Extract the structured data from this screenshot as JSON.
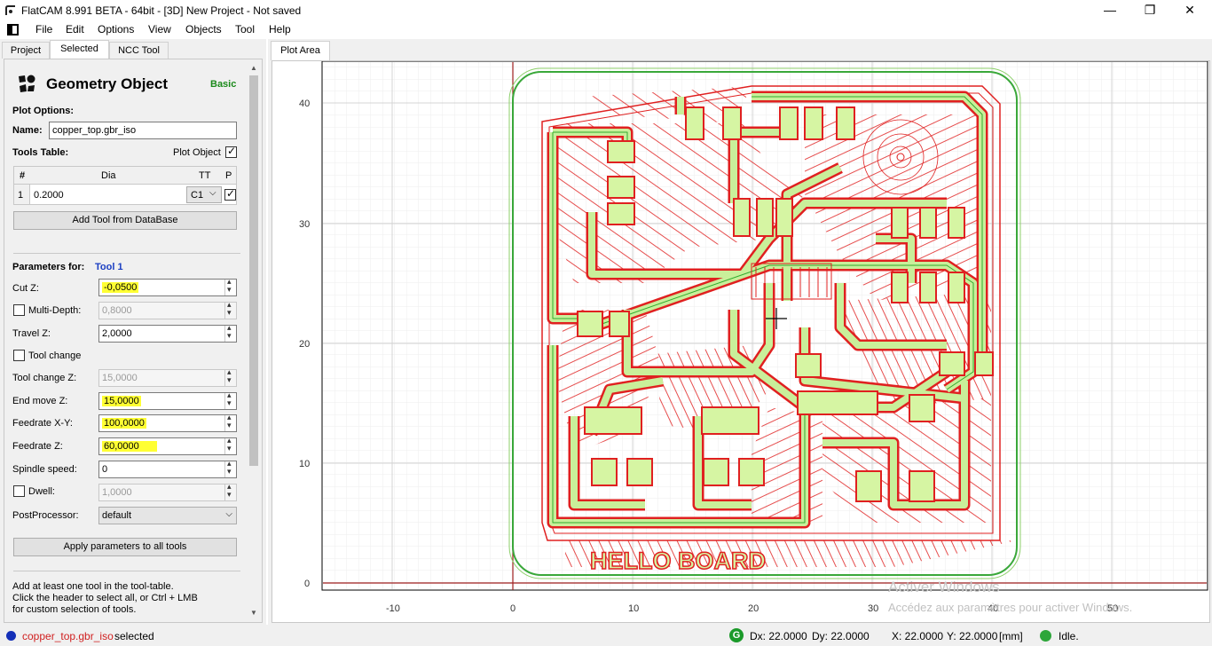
{
  "window": {
    "title": "FlatCAM 8.991 BETA - 64bit - [3D]    New Project - Not saved",
    "minimize": "—",
    "maximize": "❐",
    "close": "✕"
  },
  "menu": [
    "File",
    "Edit",
    "Options",
    "View",
    "Objects",
    "Tool",
    "Help"
  ],
  "left_tabs": [
    "Project",
    "Selected",
    "NCC Tool"
  ],
  "panel": {
    "header": "Geometry Object",
    "mode": "Basic",
    "plot_options": "Plot Options:",
    "name_label": "Name:",
    "name_value": "copper_top.gbr_iso",
    "tools_table": "Tools Table:",
    "plot_object": "Plot Object",
    "table_headers": [
      "#",
      "Dia",
      "TT",
      "P"
    ],
    "table_row": {
      "num": "1",
      "dia": "0.2000",
      "tt": "C1"
    },
    "add_tool_btn": "Add Tool from DataBase",
    "params_for": "Parameters for:",
    "tool_name": "Tool 1",
    "fields": {
      "cut_z": {
        "label": "Cut Z:",
        "value": "-0,0500"
      },
      "multi_depth": {
        "label": "Multi-Depth:",
        "value": "0,8000"
      },
      "travel_z": {
        "label": "Travel Z:",
        "value": "2,0000"
      },
      "tool_change": {
        "label": "Tool change"
      },
      "tool_change_z": {
        "label": "Tool change Z:",
        "value": "15,0000"
      },
      "end_move_z": {
        "label": "End move Z:",
        "value": "15,0000"
      },
      "feedrate_xy": {
        "label": "Feedrate X-Y:",
        "value": "100,0000"
      },
      "feedrate_z": {
        "label": "Feedrate Z:",
        "value": "60,0000"
      },
      "spindle": {
        "label": "Spindle speed:",
        "value": "0"
      },
      "dwell": {
        "label": "Dwell:",
        "value": "1,0000"
      },
      "postproc": {
        "label": "PostProcessor:",
        "value": "default"
      }
    },
    "apply_btn": "Apply parameters to all tools",
    "hint": [
      "Add at least one tool in the tool-table.",
      "Click the header to select all, or Ctrl + LMB",
      "for custom selection of tools."
    ]
  },
  "plot": {
    "tab": "Plot Area",
    "x_ticks": [
      "-10",
      "0",
      "10",
      "20",
      "30",
      "40",
      "50"
    ],
    "y_ticks": [
      "40",
      "30",
      "20",
      "10",
      "0"
    ],
    "board_text": "HELLO BOARD",
    "watermark_1": "Activer Windows",
    "watermark_2": "Accédez aux paramètres pour activer Windows."
  },
  "status": {
    "object": "copper_top.gbr_iso",
    "selected": "selected",
    "dx": "Dx: 22.0000",
    "dy": "Dy: 22.0000",
    "x": "X: 22.0000",
    "y": "Y: 22.0000",
    "units": "[mm]",
    "state": "Idle."
  },
  "colors": {
    "copper_fill": "#d6f5a3",
    "copper_stroke": "#2eab2e",
    "iso": "#e02020",
    "highlight": "#ffff33",
    "link": "#1a3ec2"
  }
}
